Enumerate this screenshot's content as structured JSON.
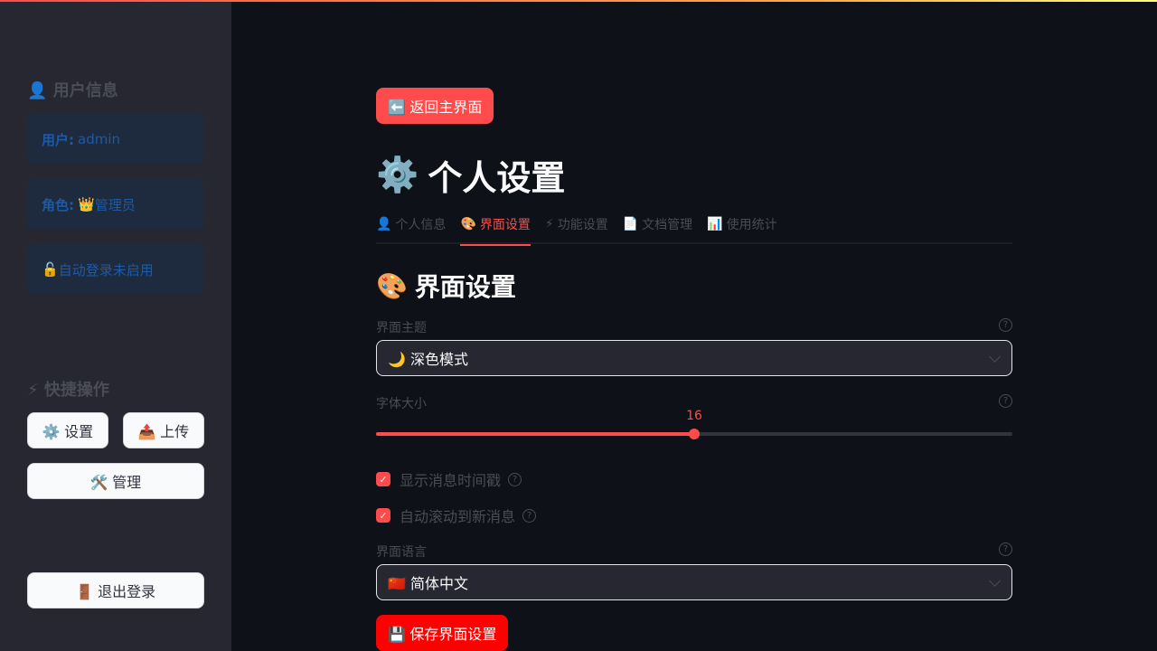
{
  "sidebar": {
    "user_section_icon": "👤",
    "user_section_title": "用户信息",
    "user_label": "用户:",
    "user_value": "admin",
    "role_label": "角色:",
    "role_icon": "👑",
    "role_value": "管理员",
    "autologin_icon": "🔓",
    "autologin_text": "自动登录未启用",
    "quick_section_icon": "⚡",
    "quick_section_title": "快捷操作",
    "settings_btn": "⚙️ 设置",
    "upload_btn": "📤 上传",
    "manage_btn": "🛠️ 管理",
    "logout_btn": "🚪 退出登录"
  },
  "main": {
    "back_btn": "⬅️ 返回主界面",
    "title_icon": "⚙️",
    "title": "个人设置",
    "tabs": [
      {
        "icon": "👤",
        "label": "个人信息"
      },
      {
        "icon": "🎨",
        "label": "界面设置"
      },
      {
        "icon": "⚡",
        "label": "功能设置"
      },
      {
        "icon": "📄",
        "label": "文档管理"
      },
      {
        "icon": "📊",
        "label": "使用统计"
      }
    ],
    "active_tab": 1,
    "section_icon": "🎨",
    "section_title": "界面设置",
    "theme_label": "界面主题",
    "theme_value": "🌙 深色模式",
    "font_label": "字体大小",
    "font_value": "16",
    "font_fraction": 0.5,
    "checkbox1_label": "显示消息时间戳",
    "checkbox2_label": "自动滚动到新消息",
    "lang_label": "界面语言",
    "lang_value": "🇨🇳 简体中文",
    "save_btn": "💾 保存界面设置",
    "accent_color": "#ff4b4b"
  }
}
